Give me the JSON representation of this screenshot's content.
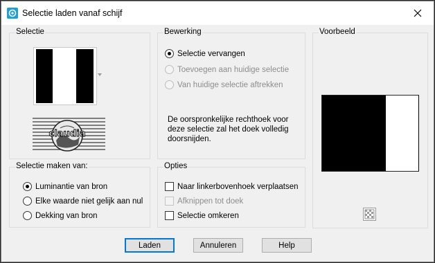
{
  "window": {
    "title": "Selectie laden vanaf schijf"
  },
  "selectie": {
    "label": "Selectie",
    "logo_text": "claudia"
  },
  "bewerking": {
    "label": "Bewerking",
    "options": [
      {
        "label": "Selectie vervangen",
        "checked": true,
        "enabled": true
      },
      {
        "label": "Toevoegen aan huidige selectie",
        "checked": false,
        "enabled": false
      },
      {
        "label": "Van huidige selectie aftrekken",
        "checked": false,
        "enabled": false
      }
    ],
    "description": "De oorspronkelijke rechthoek voor deze selectie zal het doek volledig doorsnijden."
  },
  "voorbeeld": {
    "label": "Voorbeeld"
  },
  "selectie_maken_van": {
    "label": "Selectie maken van:",
    "options": [
      {
        "label": "Luminantie van bron",
        "checked": true
      },
      {
        "label": "Elke waarde niet gelijk aan nul",
        "checked": false
      },
      {
        "label": "Dekking van bron",
        "checked": false
      }
    ]
  },
  "opties": {
    "label": "Opties",
    "options": [
      {
        "label": "Naar linkerbovenhoek verplaatsen",
        "checked": false,
        "enabled": true
      },
      {
        "label": "Afknippen tot doek",
        "checked": false,
        "enabled": false
      },
      {
        "label": "Selectie omkeren",
        "checked": false,
        "enabled": true
      }
    ]
  },
  "buttons": {
    "ok": "Laden",
    "cancel": "Annuleren",
    "help": "Help"
  }
}
